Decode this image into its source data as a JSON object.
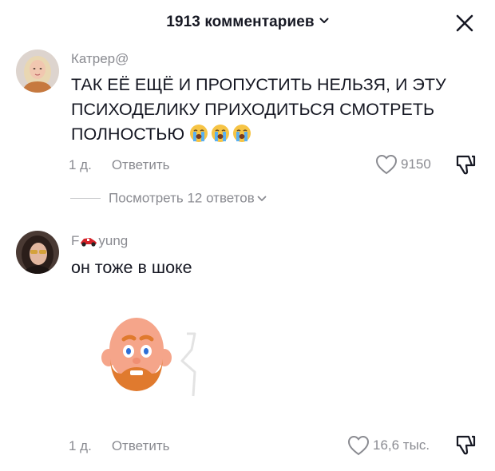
{
  "header": {
    "title": "1913 комментариев"
  },
  "comments": [
    {
      "username": "Катрер@",
      "text": "ТАК ЕЁ ЕЩЁ И ПРОПУСТИТЬ НЕЛЬЗЯ, И ЭТУ ПСИХОДЕЛИКУ ПРИХОДИТЬСЯ СМОТРЕТЬ ПОЛНОСТЬЮ",
      "emojis": [
        "loudly-crying-face",
        "loudly-crying-face",
        "loudly-crying-face"
      ],
      "time": "1 д.",
      "reply_label": "Ответить",
      "likes": "9150"
    },
    {
      "username_prefix": "F",
      "username_suffix": "yung",
      "text": "он тоже в шоке",
      "time": "1 д.",
      "reply_label": "Ответить",
      "likes": "16,6 тыс."
    }
  ],
  "view_replies": {
    "label": "Посмотреть 12 ответов"
  },
  "colors": {
    "text": "#161823",
    "secondary": "#8a8b91",
    "emoji": "#f6c445",
    "beard": "#e07a2e",
    "skin": "#f5a58a"
  }
}
